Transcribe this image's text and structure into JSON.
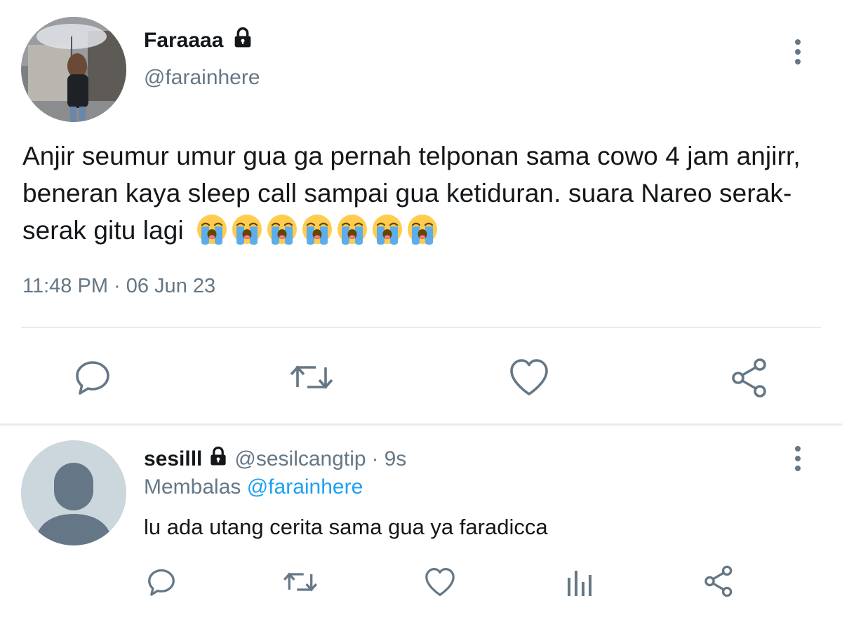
{
  "tweet": {
    "author": {
      "display_name": "Faraaaa",
      "handle": "@farainhere",
      "protected_icon": "lock-icon"
    },
    "text": "Anjir seumur umur gua ga pernah telponan sama cowo 4 jam anjirr, beneran kaya sleep call sampai gua ketiduran. suara Nareo serak-serak gitu lagi",
    "emoji": [
      "😭",
      "😭",
      "😭",
      "😭",
      "😭",
      "😭",
      "😭"
    ],
    "timestamp": "11:48 PM · 06 Jun 23",
    "actions": [
      "reply-icon",
      "retweet-icon",
      "like-icon",
      "share-icon"
    ],
    "menu_icon": "more-vertical-icon"
  },
  "reply": {
    "author": {
      "display_name": "sesilll",
      "handle": "@sesilcangtip",
      "separator": "·",
      "time": "9s",
      "protected_icon": "lock-icon"
    },
    "replying_label": "Membalas",
    "replying_to": "@farainhere",
    "text": "lu ada utang cerita sama gua ya faradicca",
    "actions": [
      "reply-icon",
      "retweet-icon",
      "like-icon",
      "analytics-icon",
      "share-icon"
    ],
    "menu_icon": "more-vertical-icon"
  },
  "colors": {
    "text": "#14171a",
    "secondary": "#657786",
    "accent": "#1da1f2",
    "icon": "#657786",
    "divider": "#e6ecf0",
    "default_avatar_bg": "#ccd6dd"
  }
}
